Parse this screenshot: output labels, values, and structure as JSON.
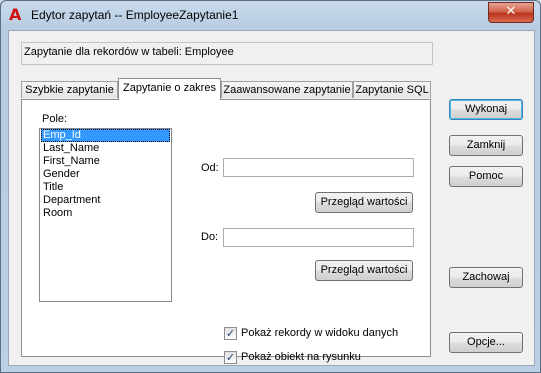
{
  "window": {
    "title": "Edytor zapytań -- EmployeeZapytanie1",
    "close_glyph": "✕",
    "app_icon_glyph": "A",
    "colors": {
      "accent": "#3399ff",
      "close": "#c7432b",
      "app_icon": "#d01010"
    }
  },
  "info": {
    "label": "Zapytanie dla rekordów w tabeli:  Employee"
  },
  "tabs": [
    {
      "label": "Szybkie zapytanie",
      "active": false
    },
    {
      "label": "Zapytanie o zakres",
      "active": true
    },
    {
      "label": "Zaawansowane zapytanie",
      "active": false
    },
    {
      "label": "Zapytanie SQL",
      "active": false
    }
  ],
  "range": {
    "field_label": "Pole:",
    "fields": [
      "Emp_Id",
      "Last_Name",
      "First_Name",
      "Gender",
      "Title",
      "Department",
      "Room"
    ],
    "selected_field": "Emp_Id",
    "from_label": "Od:",
    "from_value": "",
    "to_label": "Do:",
    "to_value": "",
    "browse_label": "Przegląd wartości"
  },
  "options": {
    "show_records": {
      "label": "Pokaż rekordy w widoku danych",
      "checked": true
    },
    "show_object": {
      "label": "Pokaż obiekt na rysunku",
      "checked": true
    },
    "check_glyph": "✓"
  },
  "side_buttons": {
    "execute": "Wykonaj",
    "close": "Zamknij",
    "help": "Pomoc",
    "save": "Zachowaj",
    "options": "Opcje..."
  }
}
